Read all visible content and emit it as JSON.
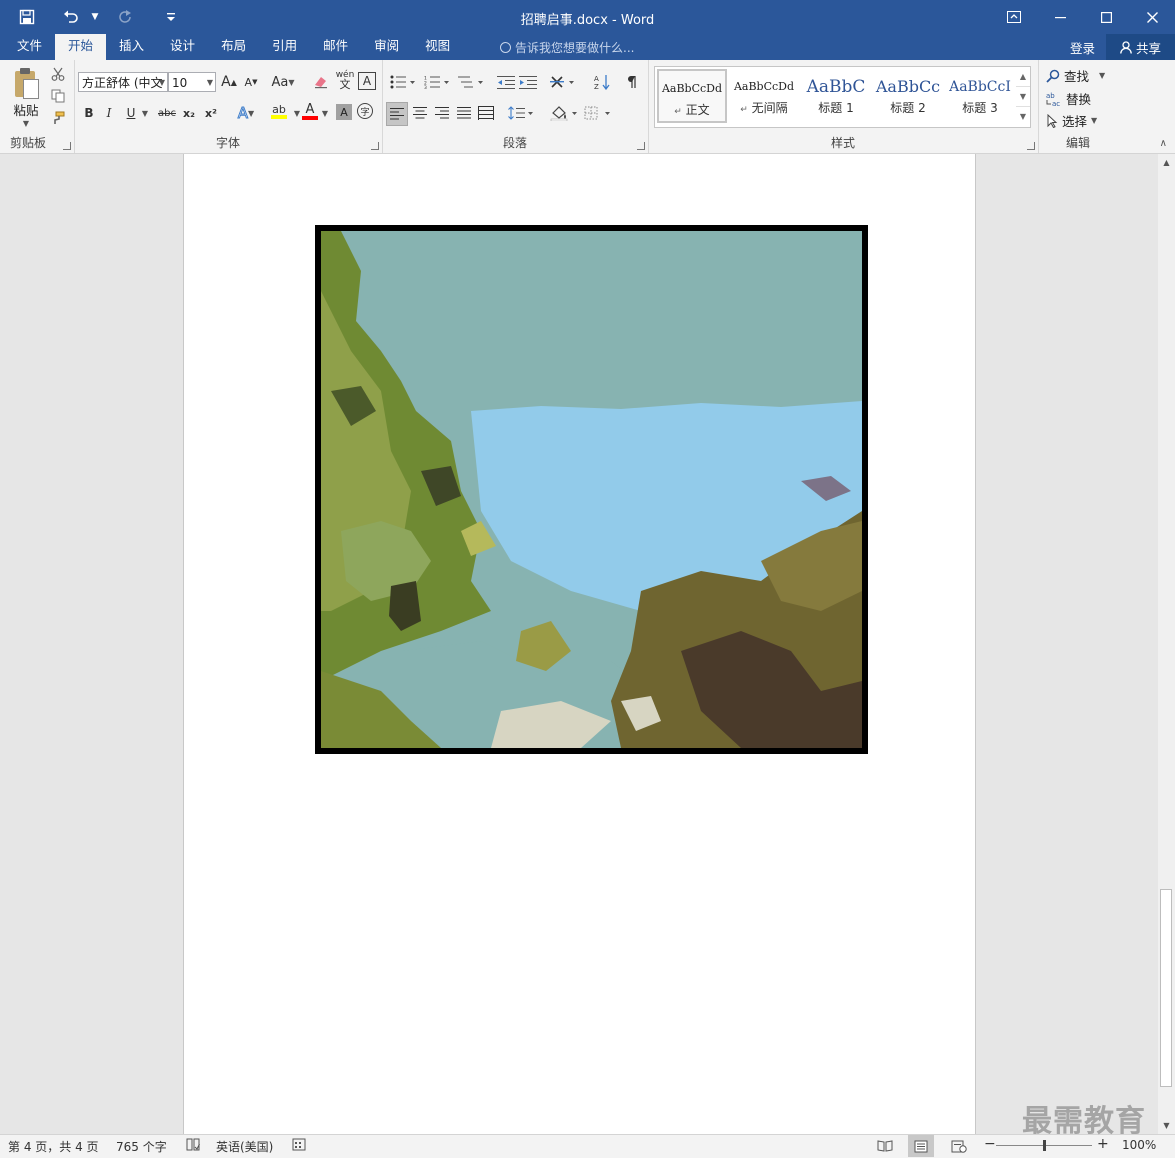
{
  "app": {
    "title": "招聘启事.docx - Word",
    "accent": "#2b579a"
  },
  "qat": {
    "save_icon": "save-icon",
    "undo_icon": "undo-icon",
    "redo_icon": "redo-icon",
    "customize_icon": "customize-icon"
  },
  "window": {
    "ribbon_display_icon": "ribbon-display-icon",
    "minimize_icon": "minimize-icon",
    "maximize_icon": "maximize-icon",
    "close_icon": "close-icon"
  },
  "tabs": [
    {
      "label": "文件"
    },
    {
      "label": "开始"
    },
    {
      "label": "插入"
    },
    {
      "label": "设计"
    },
    {
      "label": "布局"
    },
    {
      "label": "引用"
    },
    {
      "label": "邮件"
    },
    {
      "label": "审阅"
    },
    {
      "label": "视图"
    }
  ],
  "tellme": {
    "placeholder": "告诉我您想要做什么..."
  },
  "account": {
    "login": "登录",
    "share": "共享"
  },
  "ribbon": {
    "clipboard": {
      "label": "剪贴板",
      "paste": "粘贴"
    },
    "font": {
      "label": "字体",
      "font_name": "方正舒体 (中文",
      "font_size": "10",
      "grow": "A",
      "shrink": "A",
      "case": "Aa",
      "bold": "B",
      "italic": "I",
      "underline": "U",
      "strike": "abc",
      "subscript": "x₂",
      "superscript": "x²",
      "text_effects": "A",
      "highlight": "ab",
      "font_color": "A",
      "char_shading": "A",
      "phonetic": "wén",
      "char_border": "A",
      "enclose": "字",
      "highlight_color": "#ffff00",
      "font_color_value": "#ff0000"
    },
    "paragraph": {
      "label": "段落"
    },
    "styles": {
      "label": "样式",
      "items": [
        {
          "sample": "AaBbCcDd",
          "name": "正文",
          "mark": "↵"
        },
        {
          "sample": "AaBbCcDd",
          "name": "无间隔",
          "mark": "↵"
        },
        {
          "sample": "AaBbC",
          "name": "标题 1",
          "mark": ""
        },
        {
          "sample": "AaBbCc",
          "name": "标题 2",
          "mark": ""
        },
        {
          "sample": "AaBbCcI",
          "name": "标题 3",
          "mark": ""
        }
      ],
      "heading_color": "#2f5496"
    },
    "editing": {
      "label": "编辑",
      "find": "查找",
      "replace": "替换",
      "select": "选择"
    }
  },
  "document": {
    "picture": "poster-edges-landscape-picture"
  },
  "status": {
    "page": "第 4 页，共 4 页",
    "words": "765 个字",
    "language": "英语(美国)",
    "zoom_value": 100,
    "zoom_label": "100%"
  },
  "watermark": "最需教育"
}
